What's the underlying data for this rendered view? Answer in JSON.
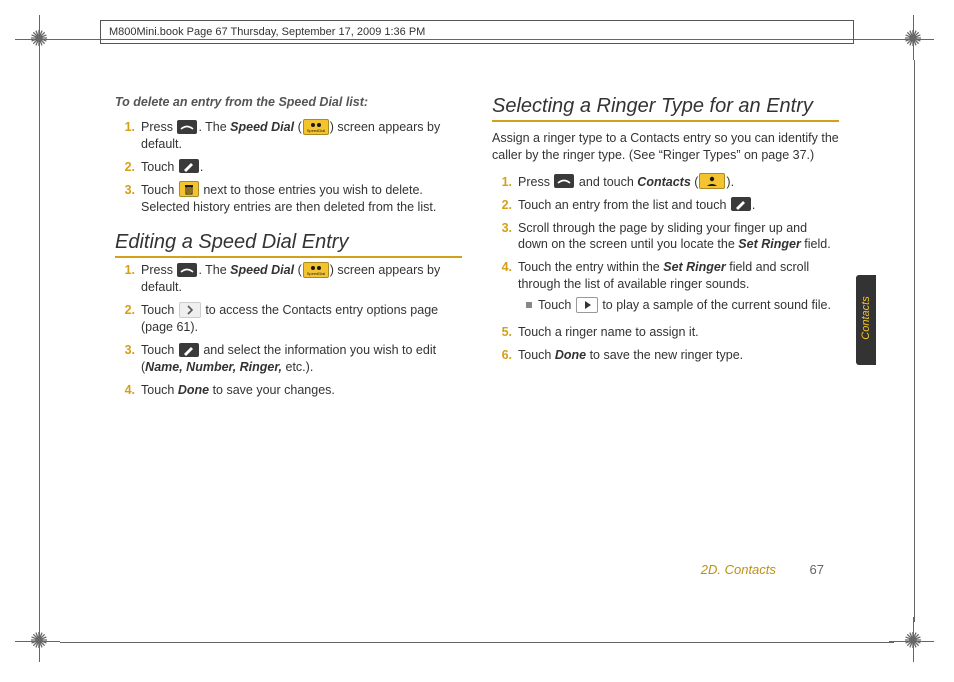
{
  "docHeader": "M800Mini.book  Page 67  Thursday, September 17, 2009  1:36 PM",
  "sideTab": "Contacts",
  "footer": {
    "section": "2D. Contacts",
    "page": "67"
  },
  "deleteIntro": "To delete an entry from the Speed Dial list:",
  "deleteSteps": {
    "s1a": "Press ",
    "s1b": ". The ",
    "s1_kw": "Speed Dial",
    "s1c": " (",
    "s1d": ") screen appears by default.",
    "s2a": "Touch ",
    "s2b": ".",
    "s3a": "Touch ",
    "s3b": " next to those entries you wish to delete. Selected history entries are then deleted from the list."
  },
  "editHeading": "Editing a Speed Dial Entry",
  "editSteps": {
    "s1a": "Press ",
    "s1b": ". The ",
    "s1_kw": "Speed Dial",
    "s1c": " (",
    "s1d": ") screen appears by default.",
    "s2a": "Touch ",
    "s2b": " to access the Contacts entry options page (page 61).",
    "s3a": "Touch ",
    "s3b": " and select the information you wish to edit (",
    "s3_kw": "Name, Number, Ringer,",
    "s3c": " etc.).",
    "s4a": "Touch ",
    "s4_kw": "Done",
    "s4b": " to save your changes."
  },
  "ringerHeading": "Selecting a Ringer Type for an Entry",
  "ringerPara": "Assign a ringer type to a Contacts entry so you can identify the caller by the ringer type. (See “Ringer Types” on page 37.)",
  "ringerSteps": {
    "s1a": "Press ",
    "s1b": " and touch ",
    "s1_kw": "Contacts",
    "s1c": " (",
    "s1d": ").",
    "s2a": "Touch an entry from the list and touch ",
    "s2b": ".",
    "s3a": "Scroll through the page by sliding your finger up and down on the screen until you locate the ",
    "s3_kw": "Set Ringer",
    "s3b": " field.",
    "s4a": "Touch the entry within the ",
    "s4_kw": "Set Ringer",
    "s4b": " field and scroll through the list of available ringer sounds.",
    "s4sub_a": "Touch ",
    "s4sub_b": " to play a sample of the current sound file.",
    "s5": "Touch a ringer name to assign it.",
    "s6a": "Touch ",
    "s6_kw": "Done",
    "s6b": " to save the new ringer type."
  }
}
